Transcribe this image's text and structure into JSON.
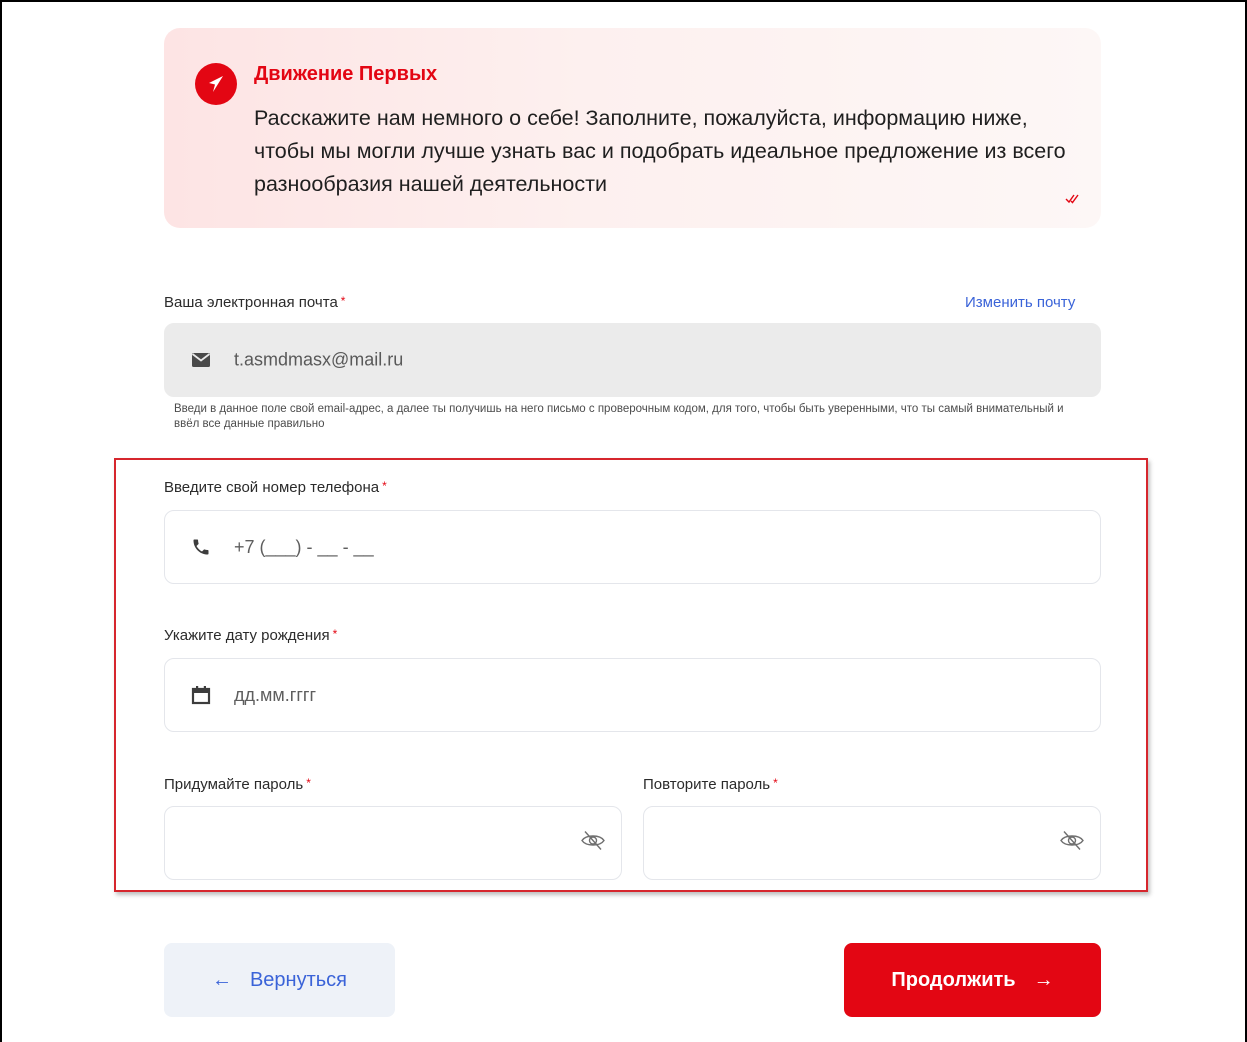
{
  "banner": {
    "title": "Движение Первых",
    "text": "Расскажите нам немного о себе! Заполните, пожалуйста, информацию ниже, чтобы мы могли лучше узнать вас и подобрать идеальное предложение из всего разнообразия нашей деятельности",
    "logo_icon": "compass-arrow-logo-icon",
    "read_icon": "double-check-icon"
  },
  "email": {
    "label": "Ваша электронная почта",
    "required_mark": "*",
    "change_link": "Изменить почту",
    "value": "t.asmdmasx@mail.ru",
    "icon": "envelope-icon",
    "hint": "Введи в данное поле свой email-адрес, а далее ты получишь на него письмо с проверочным кодом, для того, чтобы быть уверенными, что ты самый внимательный и ввёл все данные правильно"
  },
  "phone": {
    "label": "Введите свой номер телефона",
    "required_mark": "*",
    "placeholder": "+7 (___) - __ - __",
    "icon": "phone-icon"
  },
  "birthdate": {
    "label": "Укажите дату рождения",
    "required_mark": "*",
    "placeholder": "дд.мм.гггг",
    "icon": "calendar-icon"
  },
  "password": {
    "label": "Придумайте пароль",
    "required_mark": "*",
    "value": "",
    "icon": "eye-hidden-icon"
  },
  "password_repeat": {
    "label": "Повторите пароль",
    "required_mark": "*",
    "value": "",
    "icon": "eye-hidden-icon"
  },
  "actions": {
    "back_label": "Вернуться",
    "back_arrow": "←",
    "next_label": "Продолжить",
    "next_arrow": "→"
  },
  "colors": {
    "brand_red": "#e30613",
    "link_blue": "#3a63d8",
    "highlight_border": "#d6262d"
  }
}
